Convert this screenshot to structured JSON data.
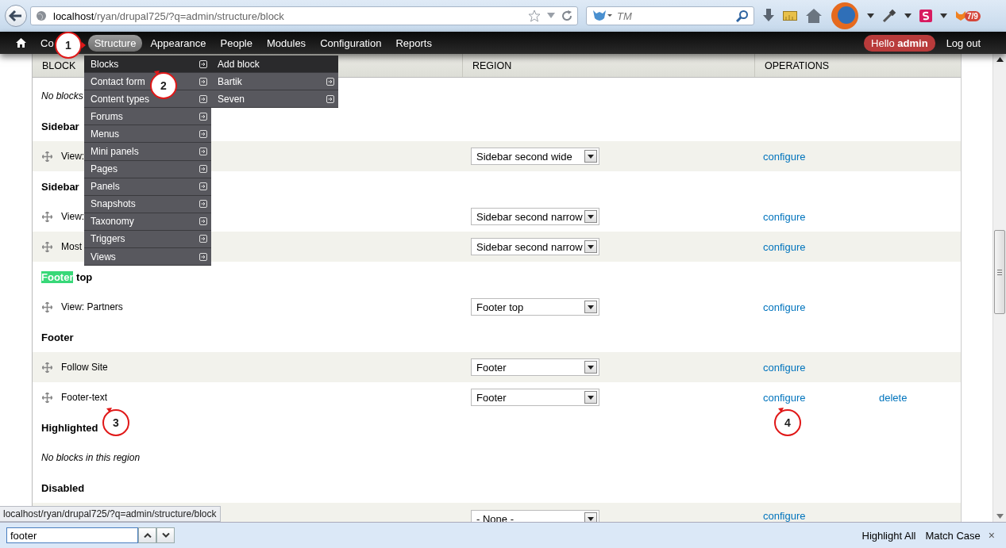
{
  "browser": {
    "url_host": "localhost",
    "url_path": "/ryan/drupal725/?q=admin/structure/block",
    "search_placeholder": "TM",
    "badge": "7/9"
  },
  "toolbar": {
    "items": [
      {
        "label": "Co",
        "selected": false
      },
      {
        "label": "Structure",
        "selected": true
      },
      {
        "label": "Appearance",
        "selected": false
      },
      {
        "label": "People",
        "selected": false
      },
      {
        "label": "Modules",
        "selected": false
      },
      {
        "label": "Configuration",
        "selected": false
      },
      {
        "label": "Reports",
        "selected": false
      }
    ],
    "greeting": "Hello **admin**",
    "logout": "Log out"
  },
  "menu": {
    "items": [
      {
        "label": "Blocks",
        "selected": true
      },
      {
        "label": "Contact form",
        "selected": false
      },
      {
        "label": "Content types",
        "selected": false
      },
      {
        "label": "Forums",
        "selected": false
      },
      {
        "label": "Menus",
        "selected": false
      },
      {
        "label": "Mini panels",
        "selected": false
      },
      {
        "label": "Pages",
        "selected": false
      },
      {
        "label": "Panels",
        "selected": false
      },
      {
        "label": "Snapshots",
        "selected": false
      },
      {
        "label": "Taxonomy",
        "selected": false
      },
      {
        "label": "Triggers",
        "selected": false
      },
      {
        "label": "Views",
        "selected": false
      }
    ],
    "submenu": [
      {
        "label": "Add block",
        "selected": true,
        "has_children": false
      },
      {
        "label": "Bartik",
        "selected": false,
        "has_children": true
      },
      {
        "label": "Seven",
        "selected": false,
        "has_children": true
      }
    ]
  },
  "table": {
    "columns": [
      "BLOCK",
      "REGION",
      "OPERATIONS"
    ],
    "rows": [
      {
        "kind": "empty",
        "text": "No blocks"
      },
      {
        "kind": "region",
        "parts": [
          {
            "text": "Sidebar",
            "highlighted": false
          }
        ]
      },
      {
        "kind": "block",
        "name": "View:",
        "region": "Sidebar second wide",
        "operations": [
          "configure"
        ]
      },
      {
        "kind": "region",
        "parts": [
          {
            "text": "Sidebar",
            "highlighted": false
          }
        ]
      },
      {
        "kind": "block",
        "name": "View:",
        "region": "Sidebar second narrow",
        "operations": [
          "configure"
        ]
      },
      {
        "kind": "block",
        "name": "Most",
        "region": "Sidebar second narrow",
        "operations": [
          "configure"
        ]
      },
      {
        "kind": "region",
        "parts": [
          {
            "text": "Footer",
            "highlighted": true
          },
          {
            "text": " top",
            "highlighted": false
          }
        ]
      },
      {
        "kind": "block",
        "name": "View: Partners",
        "region": "Footer top",
        "operations": [
          "configure"
        ]
      },
      {
        "kind": "region",
        "parts": [
          {
            "text": "Footer",
            "highlighted": false
          }
        ]
      },
      {
        "kind": "block",
        "name": "Follow Site",
        "region": "Footer",
        "operations": [
          "configure"
        ]
      },
      {
        "kind": "block",
        "name": "Footer-text",
        "region": "Footer",
        "operations": [
          "configure",
          "delete"
        ]
      },
      {
        "kind": "region",
        "parts": [
          {
            "text": "Highlighted",
            "highlighted": false
          }
        ]
      },
      {
        "kind": "empty",
        "text": "No blocks in this region"
      },
      {
        "kind": "region",
        "parts": [
          {
            "text": "Disabled",
            "highlighted": false
          }
        ]
      },
      {
        "kind": "block",
        "name": "",
        "region": "- None -",
        "operations": [
          "configure"
        ]
      }
    ]
  },
  "status_url": "localhost/ryan/drupal725/?q=admin/structure/block",
  "find_bar": {
    "value": "footer",
    "highlight_all": "Highlight All",
    "match_case": "Match Case",
    "close": "×"
  },
  "annotations": [
    "1",
    "2",
    "3",
    "4"
  ]
}
